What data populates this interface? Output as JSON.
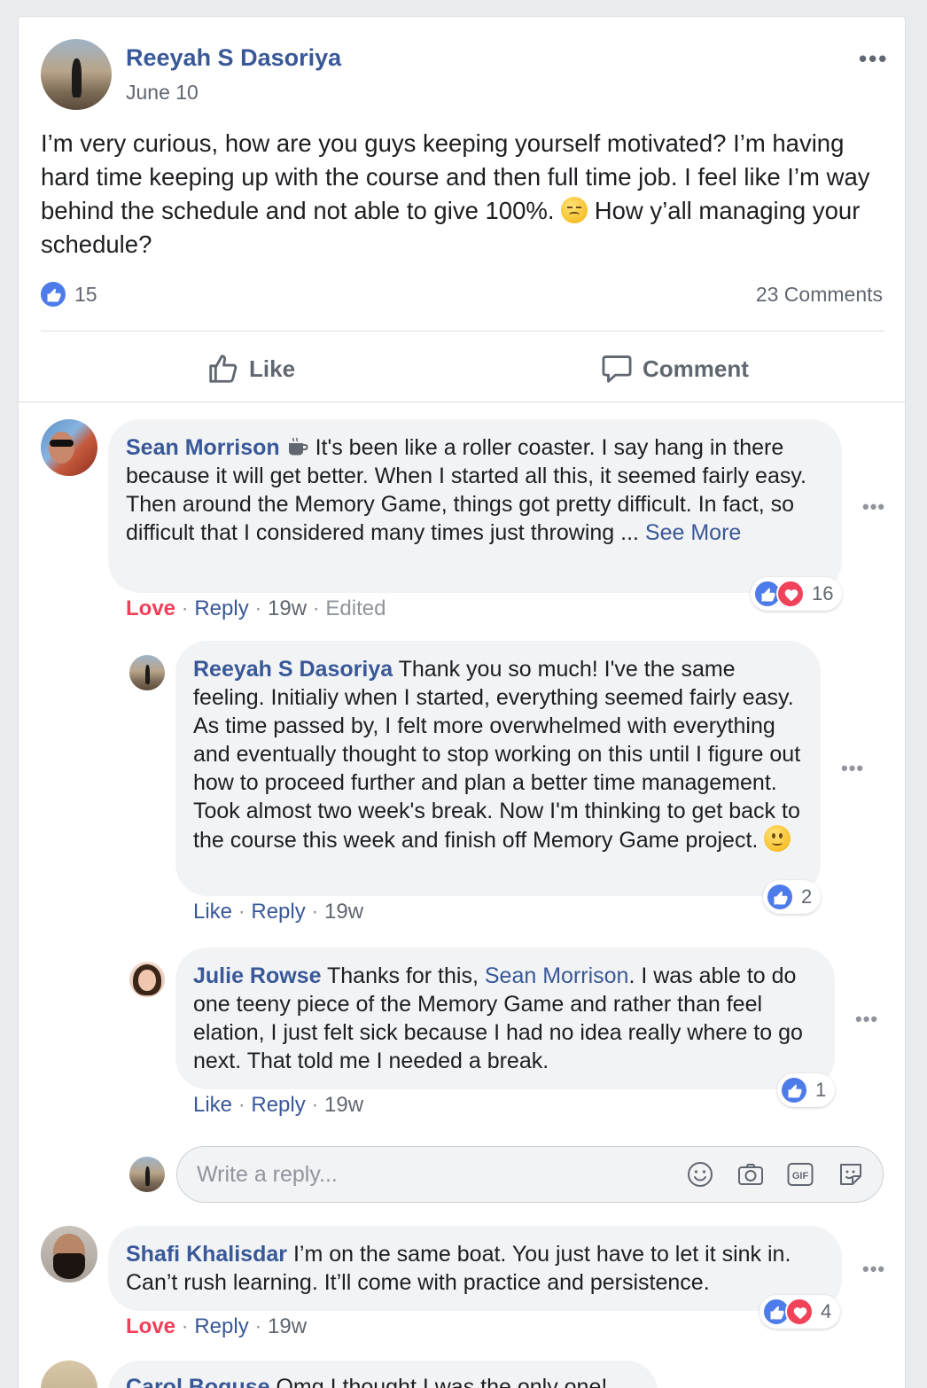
{
  "post": {
    "author": "Reeyah S Dasoriya",
    "date": "June 10",
    "more": "•••",
    "text_part1": "I’m very curious, how are you guys keeping yourself motivated? I’m having hard time keeping up with the course and then full time job. I feel like I’m way behind the schedule and not able to give 100%.",
    "text_part2": "How y’all managing your schedule?",
    "likes_count": "15",
    "comments_count": "23 Comments",
    "actions": {
      "like": "Like",
      "comment": "Comment"
    }
  },
  "comments": [
    {
      "author": "Sean Morrison",
      "text": "It's been like a roller coaster. I say hang in there because it will get better. When I started all this, it seemed fairly easy. Then around the Memory Game, things got pretty difficult. In fact, so difficult that I considered many times just throwing ...",
      "see_more": "See More",
      "reaction_label": "Love",
      "reply_label": "Reply",
      "time": "19w",
      "edited": "Edited",
      "reactions_count": "16",
      "replies": [
        {
          "author": "Reeyah S Dasoriya",
          "text": "Thank you so much! I've the same feeling. Initialiy when I started, everything seemed fairly easy. As time passed by, I felt more overwhelmed with everything and eventually thought to stop working on this until I figure out how to proceed further and plan a better time management. Took almost two week's break. Now I'm thinking to get back to the course this week and finish off Memory Game project.",
          "like_label": "Like",
          "reply_label": "Reply",
          "time": "19w",
          "reactions_count": "2"
        },
        {
          "author": "Julie Rowse",
          "text_before": "Thanks for this,",
          "mention": "Sean Morrison",
          "text_after": ". I was able to do one teeny piece of the Memory Game and rather than feel elation, I just felt sick because I had no idea really where to go next. That told me I needed a break.",
          "like_label": "Like",
          "reply_label": "Reply",
          "time": "19w",
          "reactions_count": "1"
        }
      ],
      "reply_placeholder": "Write a reply..."
    },
    {
      "author": "Shafi Khalisdar",
      "text": "I’m on the same boat. You just have to let it sink in. Can’t rush learning. It’ll come with practice and persistence.",
      "reaction_label": "Love",
      "reply_label": "Reply",
      "time": "19w",
      "reactions_count": "4"
    },
    {
      "author": "Carol Boguse",
      "text": "Omg I thought I was the only one!"
    }
  ],
  "icons": {
    "like": "like-icon",
    "love": "love-icon",
    "comment": "comment-icon",
    "emoji": "emoji-icon",
    "camera": "camera-icon",
    "gif": "gif-icon",
    "sticker": "sticker-icon",
    "coffee": "coffee-icon"
  },
  "colors": {
    "link": "#385898",
    "like_blue": "#4d7bea",
    "love_red": "#f33e58",
    "bubble_bg": "#f2f3f5",
    "page_bg": "#e9ebee"
  }
}
